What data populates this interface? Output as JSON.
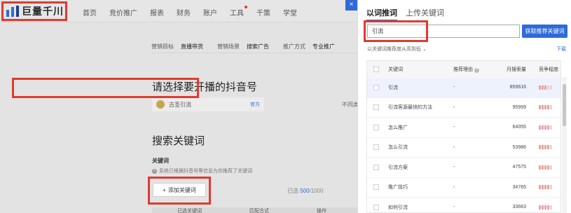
{
  "app": {
    "logo_text": "巨量千川"
  },
  "nav": {
    "items": [
      "首页",
      "竞价推广",
      "报表",
      "财务",
      "账户",
      "工具",
      "千策",
      "学堂"
    ]
  },
  "subtabs": [
    "营销目标",
    "直播带货",
    "营销场景",
    "搜索广告",
    "推广方式",
    "专业推广"
  ],
  "sections": {
    "account_title": "请选择要开播的抖音号",
    "account_name": "古圣引流",
    "account_badge": "官方",
    "account_right": "不同类",
    "search_title": "搜索关键词",
    "kw_label": "关键词",
    "kw_tip": "系统已根据抖音号等信息为你推荐了关键词",
    "add_button": "添加关键词",
    "selected_prefix": "已选",
    "selected_count": "500",
    "selected_total": "/1000",
    "left_table_headers": [
      "已选关键词",
      "匹配方式",
      "操作"
    ]
  },
  "panel": {
    "close_icon": "×",
    "tabs": [
      "以词推词",
      "上传关键词"
    ],
    "active_tab": 0,
    "search_value": "引流",
    "get_button": "获取推荐关键词",
    "hint": "以关键词推荐度从高到低",
    "download": "下载",
    "table": {
      "headers": [
        "关键词",
        "推荐理由",
        "月搜索量",
        "竞争程度"
      ],
      "rows": [
        {
          "keyword": "引流",
          "reason": "-",
          "volume": "859616",
          "competition": 3
        },
        {
          "keyword": "引流客源最快的方法",
          "reason": "-",
          "volume": "95999",
          "competition": 4
        },
        {
          "keyword": "怎么推广",
          "reason": "-",
          "volume": "64055",
          "competition": 4
        },
        {
          "keyword": "怎么引流",
          "reason": "-",
          "volume": "53986",
          "competition": 4
        },
        {
          "keyword": "引流方案",
          "reason": "-",
          "volume": "47575",
          "competition": 4
        },
        {
          "keyword": "推广技巧",
          "reason": "-",
          "volume": "34765",
          "competition": 4
        },
        {
          "keyword": "如何引流",
          "reason": "-",
          "volume": "33663",
          "competition": 4
        }
      ]
    }
  },
  "colors": {
    "accent": "#2f6bd8",
    "highlight": "#e03a2f"
  }
}
